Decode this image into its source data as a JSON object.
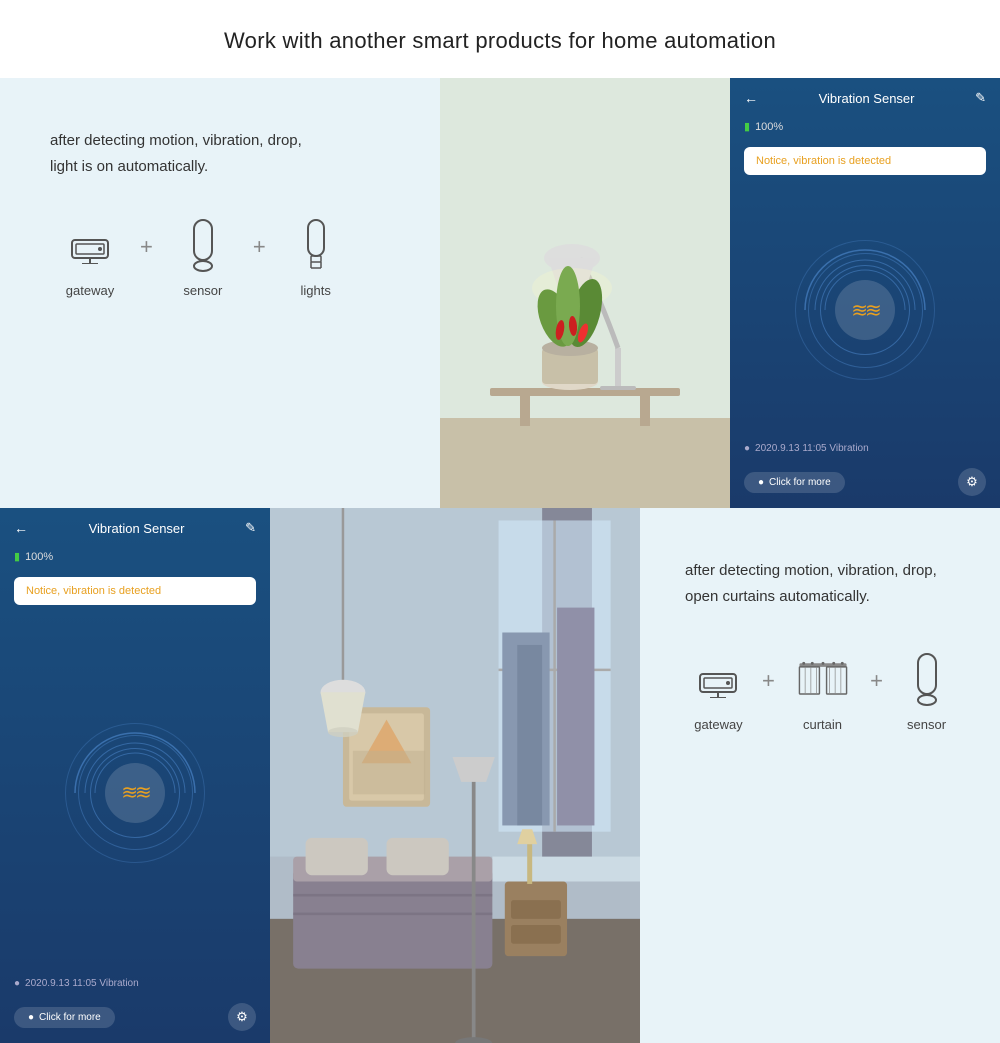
{
  "page": {
    "title": "Work with another smart products for home automation"
  },
  "top_section": {
    "left": {
      "description": "after detecting motion, vibration, drop,\nlight is on automatically.",
      "devices": [
        {
          "label": "gateway",
          "icon": "gateway"
        },
        {
          "label": "sensor",
          "icon": "sensor"
        },
        {
          "label": "lights",
          "icon": "lights"
        }
      ]
    },
    "app_ui": {
      "title": "Vibration Senser",
      "battery": "100%",
      "alert_text": "Notice, vibration is detected",
      "timestamp": "2020.9.13 11:05 Vibration",
      "click_btn": "Click for more"
    }
  },
  "bottom_section": {
    "app_ui": {
      "title": "Vibration Senser",
      "battery": "100%",
      "alert_text": "Notice, vibration is detected",
      "timestamp": "2020.9.13 11:05 Vibration",
      "click_btn": "Click for more"
    },
    "right": {
      "description": "after detecting motion, vibration, drop,\nopen curtains automatically.",
      "devices": [
        {
          "label": "gateway",
          "icon": "gateway"
        },
        {
          "label": "curtain",
          "icon": "curtain"
        },
        {
          "label": "sensor",
          "icon": "sensor"
        }
      ]
    }
  }
}
